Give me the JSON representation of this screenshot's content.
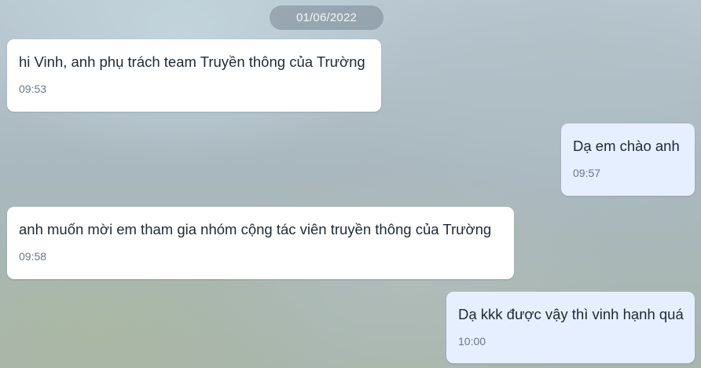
{
  "date_separator": "01/06/2022",
  "messages": [
    {
      "direction": "incoming",
      "text": "hi Vinh, anh phụ trách team Truyền thông của Trường",
      "time": "09:53"
    },
    {
      "direction": "outgoing",
      "text": "Dạ em chào anh",
      "time": "09:57"
    },
    {
      "direction": "incoming",
      "text": "anh muốn mời em tham gia nhóm cộng tác viên truyền thông của Trường",
      "time": "09:58"
    },
    {
      "direction": "outgoing",
      "text": "Dạ kkk được vậy thì vinh hạnh quá",
      "time": "10:00"
    }
  ],
  "colors": {
    "incoming_bubble": "#ffffff",
    "outgoing_bubble": "#e5efff",
    "date_pill": "#78878f"
  }
}
